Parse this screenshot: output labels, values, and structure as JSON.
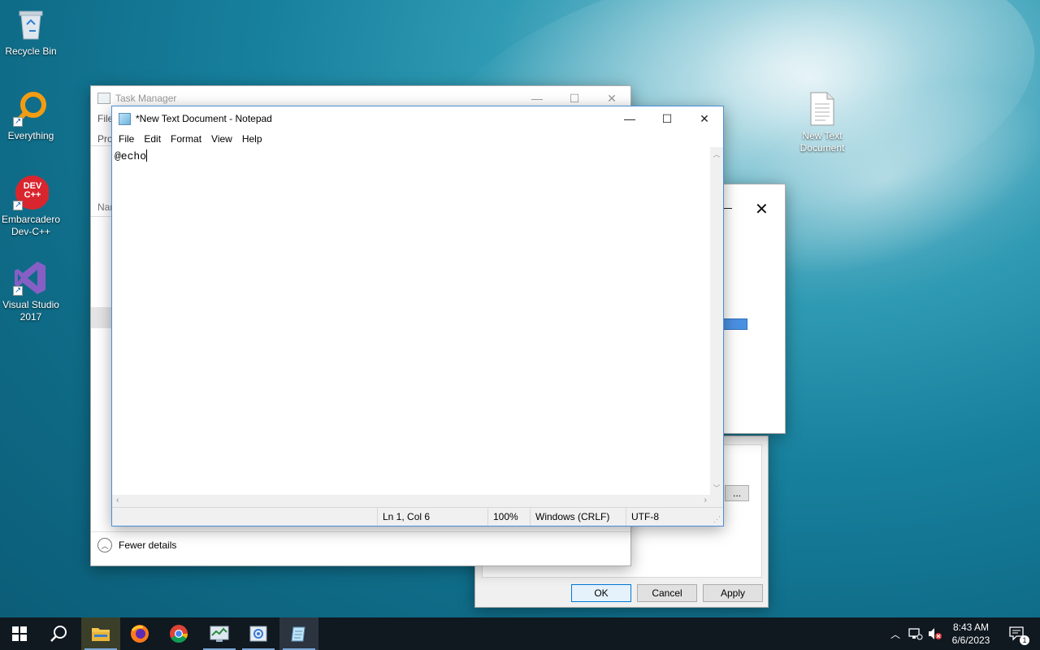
{
  "desktop": {
    "icons": [
      {
        "label": "Recycle Bin",
        "icon": "recycle-bin-icon"
      },
      {
        "label": "Everything",
        "icon": "everything-search-icon"
      },
      {
        "label": "Embarcadero Dev-C++",
        "icon": "devcpp-icon",
        "logo_text": "DEV C++"
      },
      {
        "label": "Visual Studio 2017",
        "icon": "visual-studio-icon"
      },
      {
        "label": "New Text Document",
        "icon": "text-file-icon"
      }
    ]
  },
  "task_manager": {
    "title": "Task Manager",
    "menu_file": "File",
    "tab_partial": "Pro",
    "column_partial": "Nar",
    "fewer_details": "Fewer details"
  },
  "dialog": {
    "ok": "OK",
    "cancel": "Cancel",
    "apply": "Apply",
    "ellipsis_button": "..."
  },
  "notepad": {
    "title": "*New Text Document - Notepad",
    "menu": [
      "File",
      "Edit",
      "Format",
      "View",
      "Help"
    ],
    "content": "@echo",
    "status": {
      "position": "Ln 1, Col 6",
      "zoom": "100%",
      "line_ending": "Windows (CRLF)",
      "encoding": "UTF-8"
    }
  },
  "taskbar": {
    "clock_time": "8:43 AM",
    "clock_date": "6/6/2023",
    "notification_count": "1",
    "apps": [
      "start-icon",
      "search-icon",
      "file-explorer-icon",
      "firefox-icon",
      "chrome-icon",
      "task-manager-icon",
      "control-panel-icon",
      "notepad-icon"
    ]
  },
  "colors": {
    "accent": "#0078d7",
    "taskbar": "#101820"
  }
}
